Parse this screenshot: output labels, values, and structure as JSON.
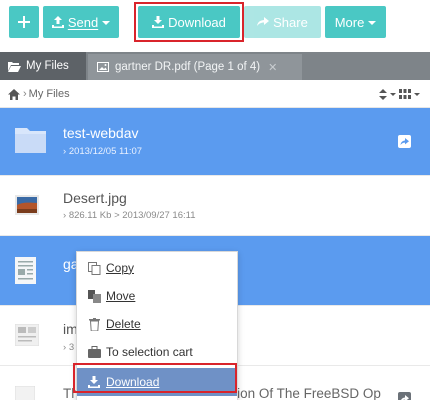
{
  "toolbar": {
    "send_label": "Send",
    "download_label": "Download",
    "share_label": "Share",
    "more_label": "More"
  },
  "tabs": [
    {
      "label": "My Files"
    },
    {
      "label": "gartner DR.pdf (Page 1 of 4)"
    }
  ],
  "breadcrumb": {
    "label": "My Files"
  },
  "files": [
    {
      "name": "test-webdav",
      "meta": "2013/12/05 11:07"
    },
    {
      "name": "Desert.jpg",
      "meta": "826.11 Kb  >  2013/09/27 16:11"
    },
    {
      "name": "ga",
      "meta": ""
    },
    {
      "name": "im",
      "meta": "3"
    },
    {
      "name": "The Design And Implementation Of The FreeBSD Op",
      "meta": ""
    }
  ],
  "context_menu": {
    "items": [
      {
        "label": "Copy"
      },
      {
        "label": "Move"
      },
      {
        "label": "Delete"
      },
      {
        "label": "To selection cart"
      },
      {
        "label": "Download"
      }
    ]
  },
  "colors": {
    "accent": "#4ac8c4",
    "selection": "#5b9bef",
    "highlight": "#d9242b"
  }
}
